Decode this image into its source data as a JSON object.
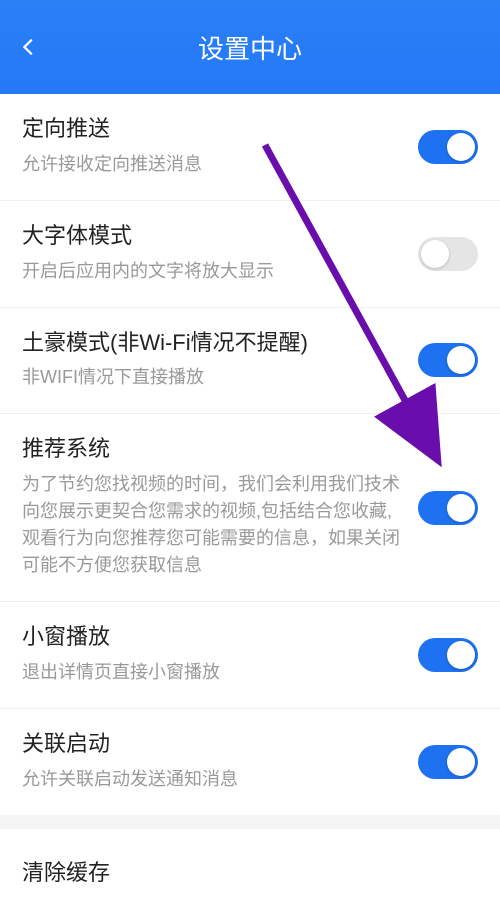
{
  "header": {
    "title": "设置中心"
  },
  "settings": [
    {
      "title": "定向推送",
      "desc": "允许接收定向推送消息",
      "on": true
    },
    {
      "title": "大字体模式",
      "desc": "开启后应用内的文字将放大显示",
      "on": false
    },
    {
      "title": "土豪模式(非Wi-Fi情况不提醒)",
      "desc": "非WIFI情况下直接播放",
      "on": true
    },
    {
      "title": "推荐系统",
      "desc": "为了节约您找视频的时间，我们会利用我们技术向您展示更契合您需求的视频,包括结合您收藏,观看行为向您推荐您可能需要的信息，如果关闭可能不方便您获取信息",
      "on": true
    },
    {
      "title": "小窗播放",
      "desc": "退出详情页直接小窗播放",
      "on": true
    },
    {
      "title": "关联启动",
      "desc": "允许关联启动发送通知消息",
      "on": true
    }
  ],
  "clearCache": {
    "label": "清除缓存"
  }
}
